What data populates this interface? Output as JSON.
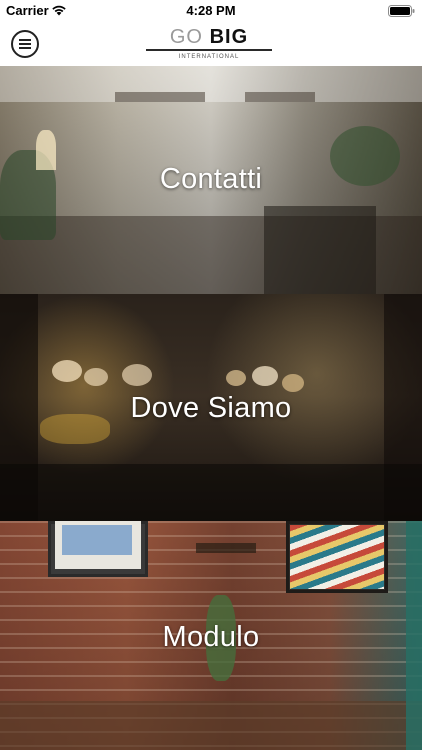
{
  "status_bar": {
    "carrier": "Carrier",
    "time": "4:28 PM",
    "wifi_icon": "wifi-icon",
    "battery_icon": "battery-icon"
  },
  "header": {
    "menu_icon": "menu-icon",
    "logo": {
      "word1": "GO",
      "word2": "BIG",
      "tagline": "INTERNATIONAL"
    }
  },
  "sections": [
    {
      "label": "Contatti"
    },
    {
      "label": "Dove Siamo"
    },
    {
      "label": "Modulo"
    }
  ],
  "colors": {
    "header_bg": "#ffffff",
    "logo_go": "#9a9a9a",
    "logo_big": "#111111",
    "section_text": "#ffffff"
  }
}
